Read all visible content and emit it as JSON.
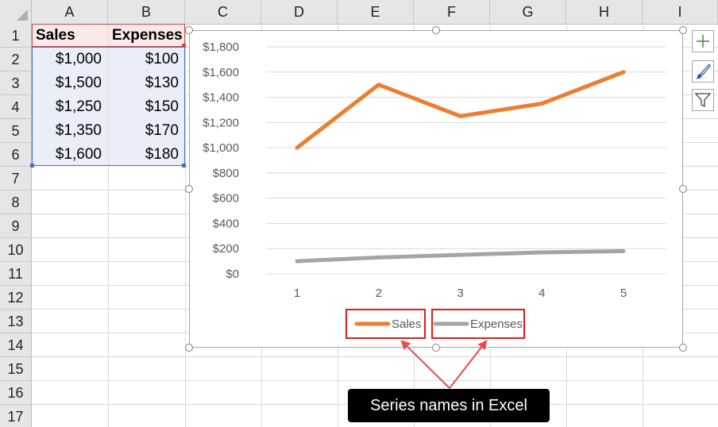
{
  "sheet": {
    "columns": [
      "A",
      "B",
      "C",
      "D",
      "E",
      "F",
      "G",
      "H",
      "I"
    ],
    "rows": [
      "1",
      "2",
      "3",
      "4",
      "5",
      "6",
      "7",
      "8",
      "9",
      "10",
      "11",
      "12",
      "13",
      "14",
      "15",
      "16",
      "17"
    ],
    "header": [
      "Sales",
      "Expenses"
    ],
    "data": [
      [
        "$1,000",
        "$100"
      ],
      [
        "$1,500",
        "$130"
      ],
      [
        "$1,250",
        "$150"
      ],
      [
        "$1,350",
        "$170"
      ],
      [
        "$1,600",
        "$180"
      ]
    ]
  },
  "chart_data": {
    "type": "line",
    "x": [
      1,
      2,
      3,
      4,
      5
    ],
    "series": [
      {
        "name": "Sales",
        "values": [
          1000,
          1500,
          1250,
          1350,
          1600
        ],
        "color": "#ed7d31"
      },
      {
        "name": "Expenses",
        "values": [
          100,
          130,
          150,
          170,
          180
        ],
        "color": "#a5a5a5"
      }
    ],
    "ylim": [
      0,
      1800
    ],
    "yticks": [
      "$0",
      "$200",
      "$400",
      "$600",
      "$800",
      "$1,000",
      "$1,200",
      "$1,400",
      "$1,600",
      "$1,800"
    ],
    "xticks": [
      "1",
      "2",
      "3",
      "4",
      "5"
    ],
    "grid": true,
    "legend": "bottom"
  },
  "side_buttons": [
    {
      "icon": "plus-icon",
      "color": "#3a9b3a"
    },
    {
      "icon": "paintbrush-icon",
      "color": "#2e5fb8"
    },
    {
      "icon": "filter-icon",
      "color": "#444444"
    }
  ],
  "annotation": {
    "callout": "Series names in Excel",
    "highlight_color": "#e01b1b"
  }
}
